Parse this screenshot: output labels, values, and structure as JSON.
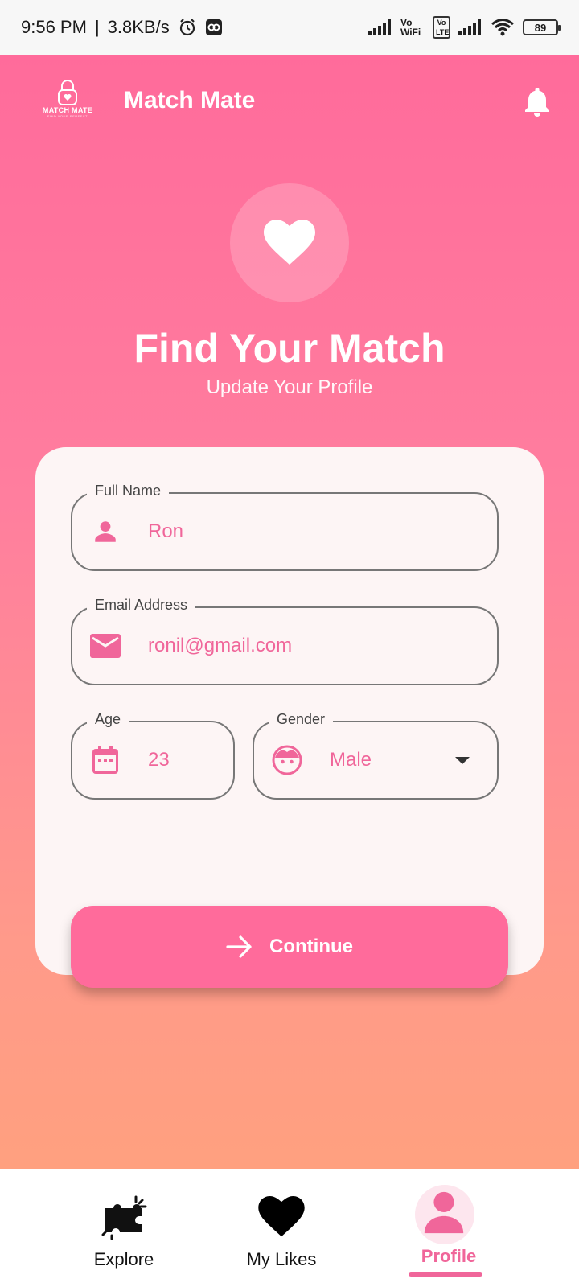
{
  "status_bar": {
    "time": "9:56 PM",
    "speed": "3.8KB/s",
    "volte": "Vo WiFi",
    "volte_lte": "Vo LTE",
    "battery": "89"
  },
  "header": {
    "logo_text": "MATCH MATE",
    "logo_sub": "FIND YOUR PERFECT",
    "title": "Match Mate",
    "bell_icon": "bell-icon"
  },
  "hero": {
    "icon": "heart-icon",
    "title": "Find Your Match",
    "subtitle": "Update Your Profile"
  },
  "form": {
    "full_name": {
      "label": "Full Name",
      "value": "Ron",
      "icon": "person-icon"
    },
    "email": {
      "label": "Email Address",
      "value": "ronil@gmail.com",
      "icon": "mail-icon"
    },
    "age": {
      "label": "Age",
      "value": "23",
      "icon": "calendar-icon"
    },
    "gender": {
      "label": "Gender",
      "value": "Male",
      "icon": "face-icon"
    },
    "continue_label": "Continue"
  },
  "nav": {
    "items": [
      {
        "label": "Explore",
        "icon": "puzzle-icon"
      },
      {
        "label": "My Likes",
        "icon": "heart-icon"
      },
      {
        "label": "Profile",
        "icon": "profile-icon",
        "active": true
      }
    ]
  },
  "colors": {
    "accent": "#ff6b9b",
    "accent_text": "#f0669a",
    "card_bg": "#fdf5f5"
  }
}
